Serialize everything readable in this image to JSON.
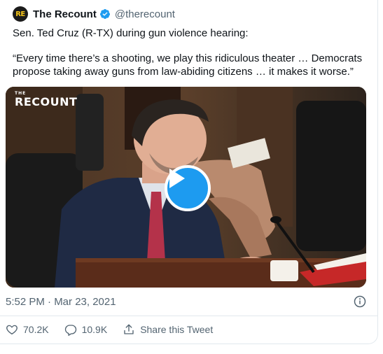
{
  "tweet": {
    "avatar_text": "RE",
    "display_name": "The Recount",
    "verified_icon": "verified-badge-icon",
    "handle": "@therecount",
    "text_line1": "Sen. Ted Cruz (R-TX) during gun violence hearing:",
    "text_quote": "“Every time there’s a shooting, we play this ridiculous theater … Democrats propose taking away guns from law-abiding citizens … it makes it worse.”",
    "timestamp": "5:52 PM · Mar 23, 2021",
    "media": {
      "watermark_small": "THE",
      "watermark_big": "RECOUNT",
      "play_icon": "play-icon"
    },
    "likes": "70.2K",
    "replies": "10.9K",
    "share_label": "Share this Tweet"
  },
  "colors": {
    "accent": "#1d9bf0",
    "text_primary": "#0f1419",
    "text_secondary": "#536471",
    "border": "#e1e8ed"
  }
}
